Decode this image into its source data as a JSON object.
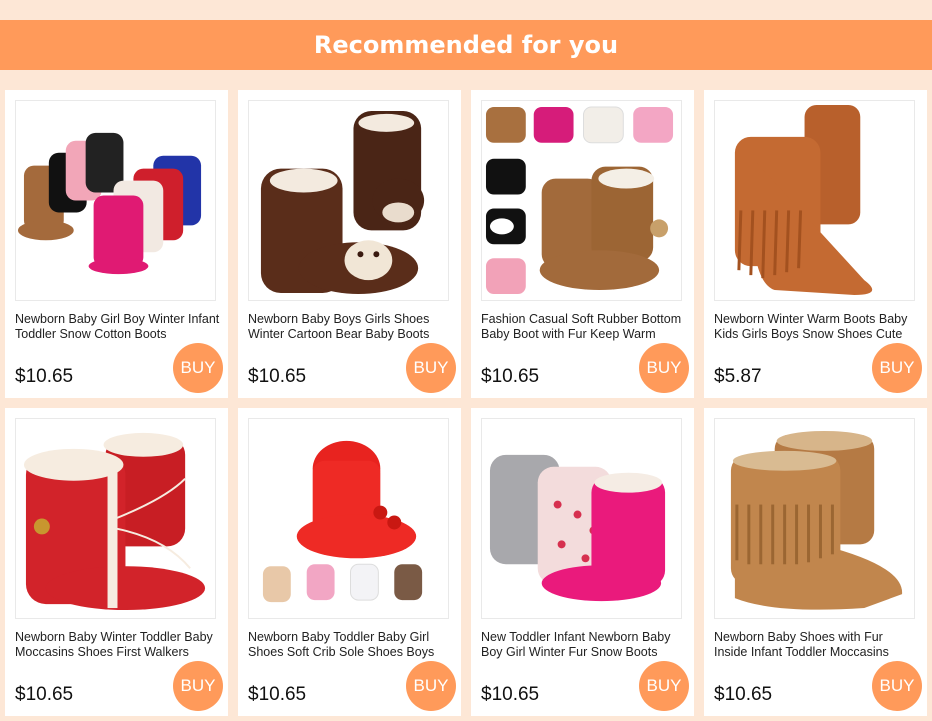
{
  "header": {
    "title": "Recommended for you"
  },
  "buy_label": "BUY",
  "products": [
    {
      "title": "Newborn Baby Girl Boy Winter Infant Toddler Snow Cotton Boots",
      "price": "$10.65",
      "image": "assorted-color-baby-boots"
    },
    {
      "title": "Newborn Baby Boys Girls Shoes Winter Cartoon Bear Baby Boots",
      "price": "$10.65",
      "image": "brown-knit-bear-boots"
    },
    {
      "title": "Fashion Casual Soft Rubber Bottom Baby Boot with Fur Keep Warm",
      "price": "$10.65",
      "image": "fur-lined-baby-boots-collage"
    },
    {
      "title": "Newborn Winter Warm Boots Baby Kids Girls Boys Snow Shoes Cute",
      "price": "$5.87",
      "image": "orange-fringe-boots"
    },
    {
      "title": "Newborn Baby Winter Toddler Baby Moccasins Shoes First Walkers",
      "price": "$10.65",
      "image": "red-fur-lace-boots"
    },
    {
      "title": "Newborn Baby Toddler Baby Girl Shoes Soft Crib Sole Shoes Boys",
      "price": "$10.65",
      "image": "red-pompom-boots-collage"
    },
    {
      "title": "New Toddler Infant Newborn Baby Boy Girl Winter Fur Snow Boots",
      "price": "$10.65",
      "image": "pink-grey-knit-heart-boots"
    },
    {
      "title": "Newborn Baby Shoes with Fur Inside Infant Toddler Moccasins",
      "price": "$10.65",
      "image": "tan-fringe-moccasin-boots"
    }
  ],
  "colors": {
    "accent": "#ff9a5a",
    "background": "#fde7d6"
  }
}
